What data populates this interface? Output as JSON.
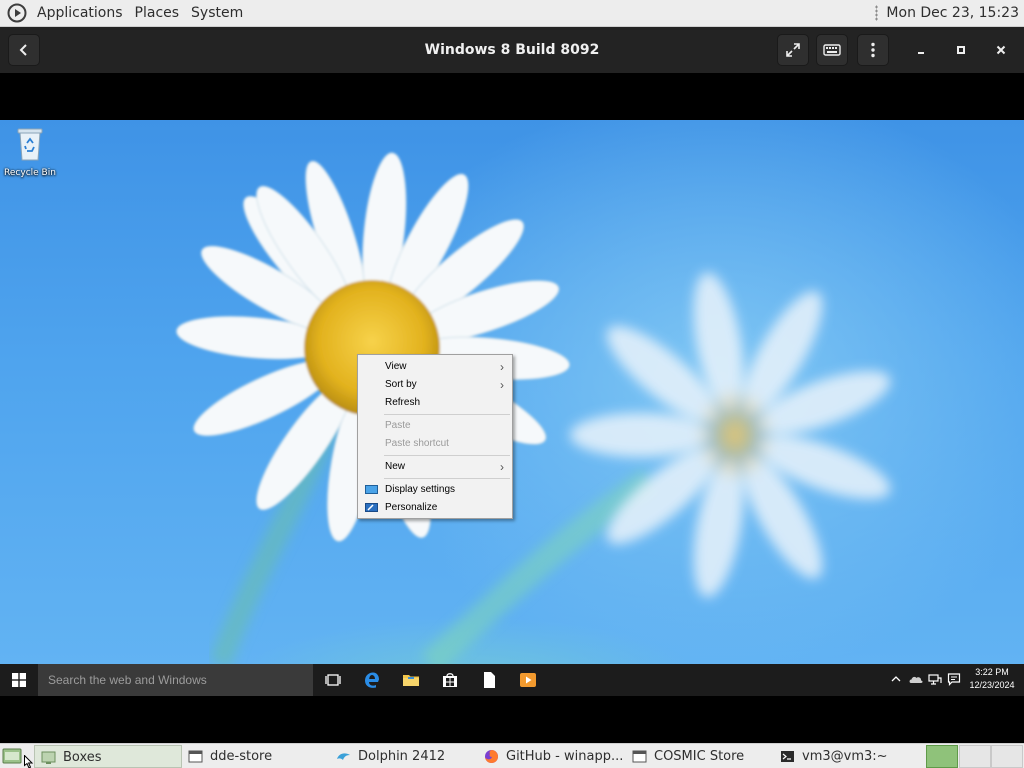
{
  "top_panel": {
    "menus": [
      "Applications",
      "Places",
      "System"
    ],
    "clock": "Mon Dec 23, 15:23"
  },
  "header": {
    "title": "Windows 8 Build 8092",
    "buttons": [
      "back-icon",
      "fullscreen-icon",
      "keyboard-icon",
      "kebab-menu-icon",
      "minimize-icon",
      "maximize-icon",
      "close-icon"
    ]
  },
  "desktop": {
    "icons": [
      {
        "label": "Recycle Bin",
        "icon": "recycle-bin-icon"
      }
    ]
  },
  "context_menu": {
    "items": [
      {
        "label": "View",
        "submenu": true,
        "enabled": true
      },
      {
        "label": "Sort by",
        "submenu": true,
        "enabled": true
      },
      {
        "label": "Refresh",
        "submenu": false,
        "enabled": true
      },
      {
        "label": "Paste",
        "submenu": false,
        "enabled": false
      },
      {
        "label": "Paste shortcut",
        "submenu": false,
        "enabled": false
      },
      {
        "label": "New",
        "submenu": true,
        "enabled": true
      },
      {
        "label": "Display settings",
        "submenu": false,
        "enabled": true,
        "icon": "display-icon"
      },
      {
        "label": "Personalize",
        "submenu": false,
        "enabled": true,
        "icon": "personalize-icon"
      }
    ]
  },
  "win_taskbar": {
    "search_placeholder": "Search the web and Windows",
    "pinned": [
      "task-view-icon",
      "edge-icon",
      "file-explorer-icon",
      "store-icon",
      "document-icon",
      "media-player-icon"
    ],
    "tray": [
      "chevron-up-icon",
      "onedrive-icon",
      "network-icon",
      "notification-icon"
    ],
    "time": "3:22 PM",
    "date": "12/23/2024"
  },
  "bottom_panel": {
    "tasks": [
      {
        "label": "Boxes",
        "icon": "boxes-icon",
        "active": true
      },
      {
        "label": "dde-store",
        "icon": "window-icon",
        "active": false
      },
      {
        "label": "Dolphin 2412",
        "icon": "dolphin-icon",
        "active": false
      },
      {
        "label": "GitHub - winapp...",
        "icon": "firefox-icon",
        "active": false
      },
      {
        "label": "COSMIC Store",
        "icon": "window-icon",
        "active": false
      },
      {
        "label": "vm3@vm3:~",
        "icon": "terminal-icon",
        "active": false
      }
    ],
    "workspaces": 3,
    "current_workspace": 1
  },
  "colors": {
    "panel": "#ededed",
    "header": "#232323",
    "win_taskbar": "#1c1c1c",
    "sky": "#4fa4ee",
    "workspace_active": "#8fc27a"
  }
}
